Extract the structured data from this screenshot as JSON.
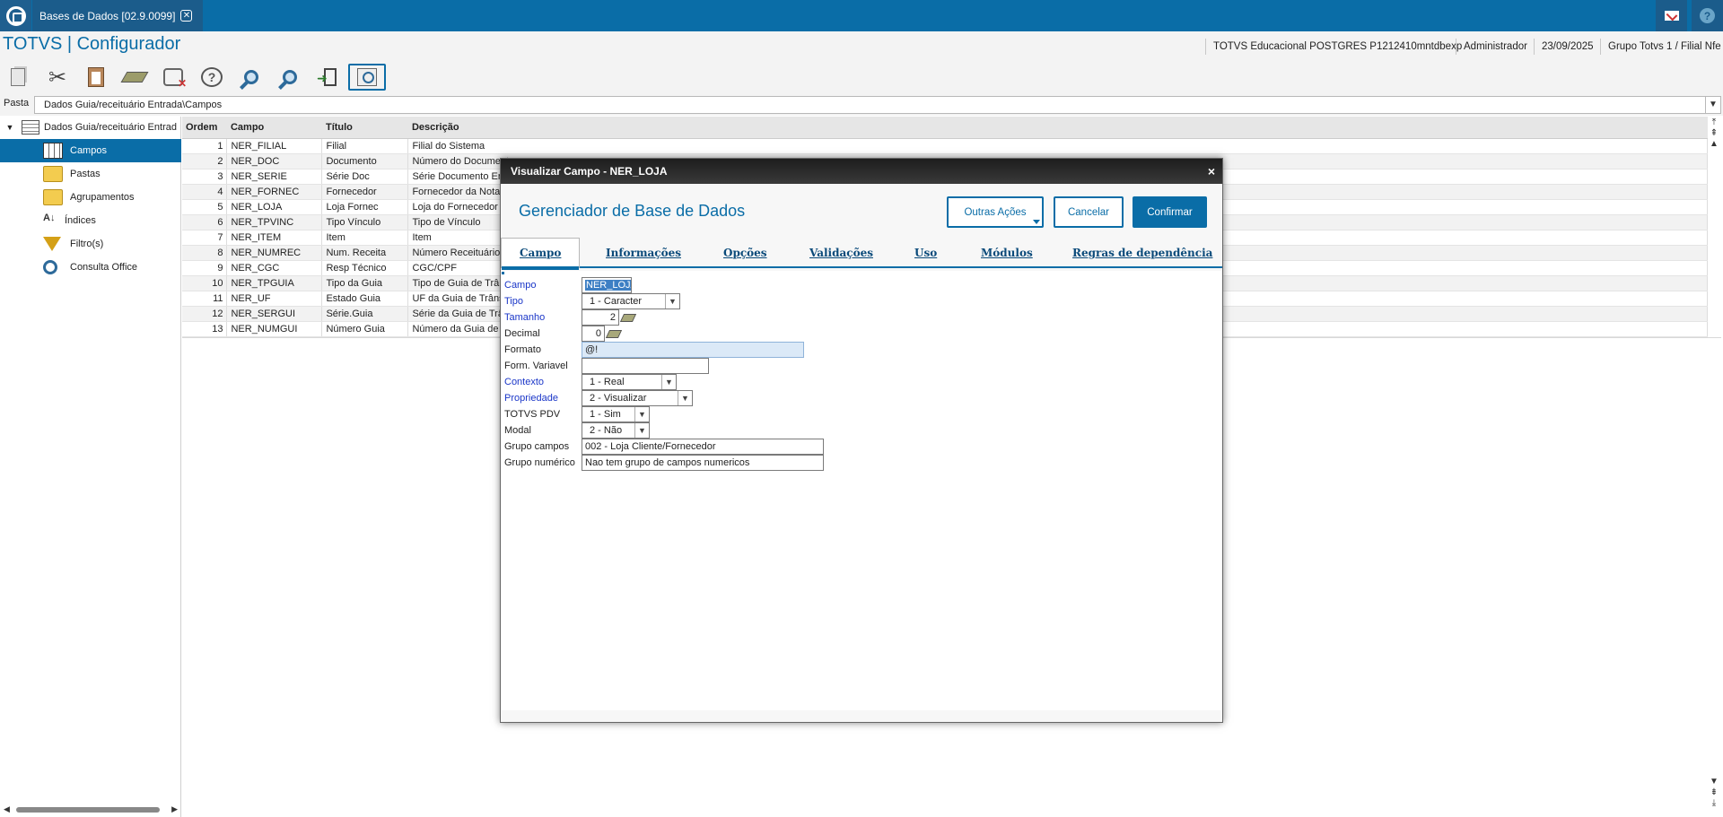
{
  "topbar": {
    "tab_label": "Bases de Dados [02.9.0099]",
    "close_glyph": "✕"
  },
  "header": {
    "app_title": "TOTVS | Configurador",
    "environment": "TOTVS Educacional POSTGRES P1212410mntdbexp",
    "user": "Administrador",
    "date": "23/09/2025",
    "company": "Grupo Totvs 1 / Filial Nfe"
  },
  "toolbar": {
    "icons": [
      "copy-icon",
      "cut-icon",
      "paste-icon",
      "eraser-icon",
      "database-delete-icon",
      "help-icon",
      "search-icon",
      "search-next-icon",
      "exit-icon",
      "view-icon"
    ]
  },
  "pasta": {
    "label": "Pasta",
    "value": "Dados Guia/receituário Entrada\\Campos"
  },
  "tree": {
    "root_label": "Dados Guia/receituário Entrad",
    "items": [
      {
        "label": "Campos",
        "icon": "grid-icon",
        "selected": true
      },
      {
        "label": "Pastas",
        "icon": "folder-icon"
      },
      {
        "label": "Agrupamentos",
        "icon": "folder-group-icon"
      },
      {
        "label": "Índices",
        "icon": "sort-az-icon"
      },
      {
        "label": "Filtro(s)",
        "icon": "filter-icon"
      },
      {
        "label": "Consulta Office",
        "icon": "search-icon"
      }
    ]
  },
  "grid": {
    "columns": [
      "Ordem",
      "Campo",
      "Título",
      "Descrição"
    ],
    "rows": [
      [
        "1",
        "NER_FILIAL",
        "Filial",
        "Filial do Sistema"
      ],
      [
        "2",
        "NER_DOC",
        "Documento",
        "Número do Documento"
      ],
      [
        "3",
        "NER_SERIE",
        "Série Doc",
        "Série Documento Entrada"
      ],
      [
        "4",
        "NER_FORNEC",
        "Fornecedor",
        "Fornecedor da Nota"
      ],
      [
        "5",
        "NER_LOJA",
        "Loja Fornec",
        "Loja do Fornecedor"
      ],
      [
        "6",
        "NER_TPVINC",
        "Tipo Vínculo",
        "Tipo de Vínculo"
      ],
      [
        "7",
        "NER_ITEM",
        "Item",
        "Item"
      ],
      [
        "8",
        "NER_NUMREC",
        "Num. Receita",
        "Número Receituário"
      ],
      [
        "9",
        "NER_CGC",
        "Resp Técnico",
        "CGC/CPF"
      ],
      [
        "10",
        "NER_TPGUIA",
        "Tipo da Guia",
        "Tipo de Guia de Trânsito"
      ],
      [
        "11",
        "NER_UF",
        "Estado Guia",
        "UF da Guia de Trânsito"
      ],
      [
        "12",
        "NER_SERGUI",
        "Série.Guia",
        "Série da Guia de Trânsito"
      ],
      [
        "13",
        "NER_NUMGUI",
        "Número Guia",
        "Número da Guia de Trânsito"
      ]
    ]
  },
  "modal": {
    "title": "Visualizar Campo - NER_LOJA",
    "close_glyph": "×",
    "heading": "Gerenciador de Base de Dados",
    "buttons": {
      "other_actions": "Outras Ações",
      "cancel": "Cancelar",
      "confirm": "Confirmar"
    },
    "tabs": [
      "Campo",
      "Informações",
      "Opções",
      "Validações",
      "Uso",
      "Módulos",
      "Regras de dependência"
    ],
    "fields": {
      "campo": {
        "label": "Campo",
        "value": "NER_LOJA"
      },
      "tipo": {
        "label": "Tipo",
        "value": "1 - Caracter"
      },
      "tamanho": {
        "label": "Tamanho",
        "value": "2"
      },
      "decimal": {
        "label": "Decimal",
        "value": "0"
      },
      "formato": {
        "label": "Formato",
        "value": "@!"
      },
      "form_variavel": {
        "label": "Form. Variavel",
        "value": ""
      },
      "contexto": {
        "label": "Contexto",
        "value": "1 - Real"
      },
      "propriedade": {
        "label": "Propriedade",
        "value": "2 - Visualizar"
      },
      "totvs_pdv": {
        "label": "TOTVS PDV",
        "value": "1 - Sim"
      },
      "modal": {
        "label": "Modal",
        "value": "2 - Não"
      },
      "grupo_campos": {
        "label": "Grupo campos",
        "value": "002 - Loja Cliente/Fornecedor"
      },
      "grupo_numerico": {
        "label": "Grupo numérico",
        "value": "Nao tem grupo de campos numericos"
      }
    }
  },
  "colors": {
    "brand": "#0a6da7",
    "required_label": "#1a36c8",
    "modal_title_bg": "#2a2a2a"
  }
}
